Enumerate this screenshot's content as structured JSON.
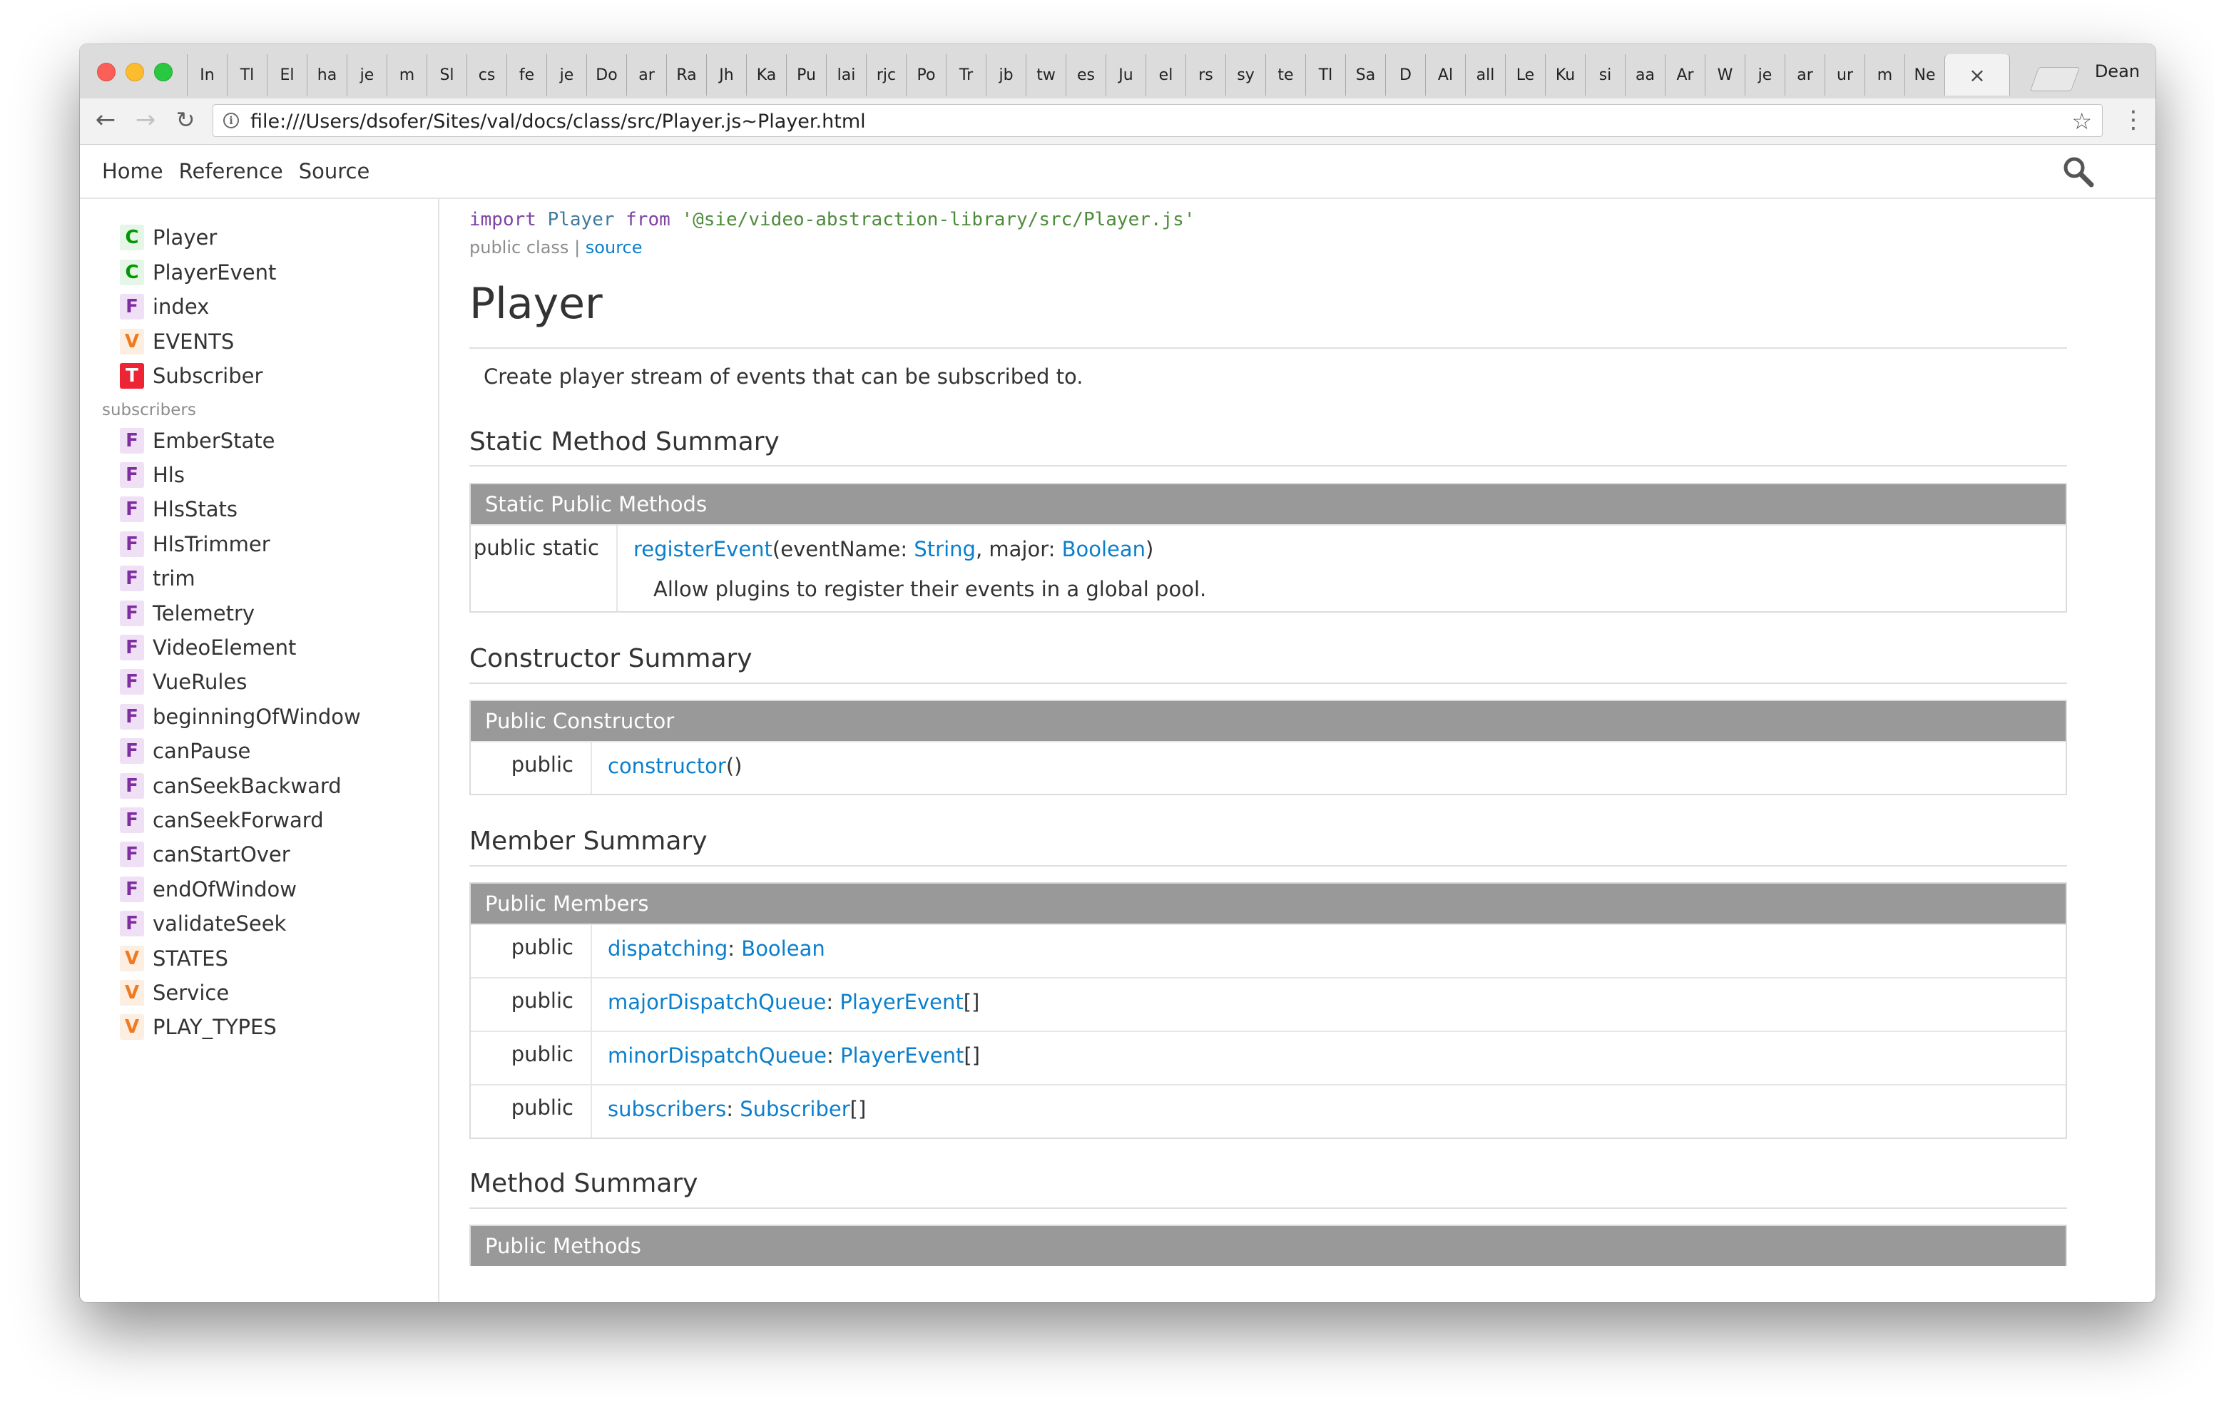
{
  "window": {
    "tabs": [
      "In",
      "Tl",
      "El",
      "ha",
      "je",
      "m",
      "Sl",
      "cs",
      "fe",
      "je",
      "Do",
      "ar",
      "Ra",
      "Jh",
      "Ka",
      "Pu",
      "lai",
      "rjc",
      "Po",
      "Tr",
      "jb",
      "tw",
      "es",
      "Ju",
      "el",
      "rs",
      "sy",
      "te",
      "Tl",
      "Sa",
      "D",
      "Al",
      "all",
      "Le",
      "Ku",
      "si",
      "aa",
      "Ar",
      "W",
      "je",
      "ar",
      "ur",
      "m",
      "Ne"
    ],
    "active_tab_close": "×",
    "profile_name": "Dean"
  },
  "address_bar": {
    "url": "file:///Users/dsofer/Sites/val/docs/class/src/Player.js~Player.html",
    "info_glyph": "i",
    "back_glyph": "←",
    "forward_glyph": "→",
    "reload_glyph": "↻",
    "star_glyph": "☆",
    "menu_glyph": "⋮"
  },
  "header": {
    "nav": [
      "Home",
      "Reference",
      "Source"
    ],
    "search_icon": "search-icon"
  },
  "sidebar": {
    "top_items": [
      {
        "badge": "C",
        "name": "Player"
      },
      {
        "badge": "C",
        "name": "PlayerEvent"
      },
      {
        "badge": "F",
        "name": "index"
      },
      {
        "badge": "V",
        "name": "EVENTS"
      },
      {
        "badge": "T",
        "name": "Subscriber"
      }
    ],
    "dir_label": "subscribers",
    "dir_items": [
      {
        "badge": "F",
        "name": "EmberState"
      },
      {
        "badge": "F",
        "name": "Hls"
      },
      {
        "badge": "F",
        "name": "HlsStats"
      },
      {
        "badge": "F",
        "name": "HlsTrimmer"
      },
      {
        "badge": "F",
        "name": "trim"
      },
      {
        "badge": "F",
        "name": "Telemetry"
      },
      {
        "badge": "F",
        "name": "VideoElement"
      },
      {
        "badge": "F",
        "name": "VueRules"
      },
      {
        "badge": "F",
        "name": "beginningOfWindow"
      },
      {
        "badge": "F",
        "name": "canPause"
      },
      {
        "badge": "F",
        "name": "canSeekBackward"
      },
      {
        "badge": "F",
        "name": "canSeekForward"
      },
      {
        "badge": "F",
        "name": "canStartOver"
      },
      {
        "badge": "F",
        "name": "endOfWindow"
      },
      {
        "badge": "F",
        "name": "validateSeek"
      },
      {
        "badge": "V",
        "name": "STATES"
      },
      {
        "badge": "V",
        "name": "Service"
      },
      {
        "badge": "V",
        "name": "PLAY_TYPES"
      }
    ]
  },
  "content": {
    "import_kw": "import",
    "import_name": "Player",
    "from_kw": "from",
    "import_path": "'@sie/video-abstraction-library/src/Player.js'",
    "kind": "public class",
    "kind_sep": "|",
    "source_link": "source",
    "title": "Player",
    "description": "Create player stream of events that can be subscribed to.",
    "static_method_summary": {
      "title": "Static Method Summary",
      "header": "Static Public Methods",
      "row": {
        "modifier": "public static",
        "name": "registerEvent",
        "open": "(eventName: ",
        "type1": "String",
        "mid": ", major: ",
        "type2": "Boolean",
        "close": ")",
        "desc": "Allow plugins to register their events in a global pool."
      }
    },
    "constructor_summary": {
      "title": "Constructor Summary",
      "header": "Public Constructor",
      "row": {
        "modifier": "public",
        "name": "constructor",
        "suffix": "()"
      }
    },
    "member_summary": {
      "title": "Member Summary",
      "header": "Public Members",
      "rows": [
        {
          "modifier": "public",
          "name": "dispatching",
          "sep": ": ",
          "type": "Boolean",
          "suffix": ""
        },
        {
          "modifier": "public",
          "name": "majorDispatchQueue",
          "sep": ": ",
          "type": "PlayerEvent",
          "suffix": "[]"
        },
        {
          "modifier": "public",
          "name": "minorDispatchQueue",
          "sep": ": ",
          "type": "PlayerEvent",
          "suffix": "[]"
        },
        {
          "modifier": "public",
          "name": "subscribers",
          "sep": ": ",
          "type": "Subscriber",
          "suffix": "[]"
        }
      ]
    },
    "method_summary": {
      "title": "Method Summary",
      "header": "Public Methods"
    }
  }
}
